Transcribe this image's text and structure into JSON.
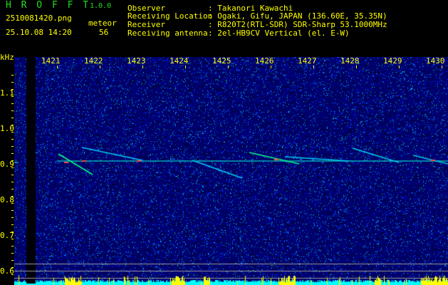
{
  "app": {
    "title": "H R O F F T",
    "version": "1.0.0"
  },
  "file": {
    "name": "2510081420.png",
    "datetime": "25.10.08 14:20"
  },
  "detection": {
    "label": "meteor",
    "count": "56"
  },
  "info": [
    {
      "label": "Observer",
      "value": "Takanori Kawachi"
    },
    {
      "label": "Receiving Location",
      "value": "Ogaki, Gifu, JAPAN (136.60E, 35.35N)"
    },
    {
      "label": "Receiver",
      "value": "R820T2(RTL-SDR) SDR-Sharp 53.1000MHz"
    },
    {
      "label": "Receiving antenna",
      "value": "2el-HB9CV Vertical (el. E-W)"
    }
  ],
  "axis": {
    "y_unit": "kHz",
    "y_labels": [
      "1.1",
      "1.0",
      "0.9",
      "0.8",
      "0.7",
      "0.6"
    ],
    "x_labels": [
      "1421",
      "1422",
      "1423",
      "1424",
      "1425",
      "1426",
      "1427",
      "1428",
      "1429",
      "1430"
    ]
  }
}
